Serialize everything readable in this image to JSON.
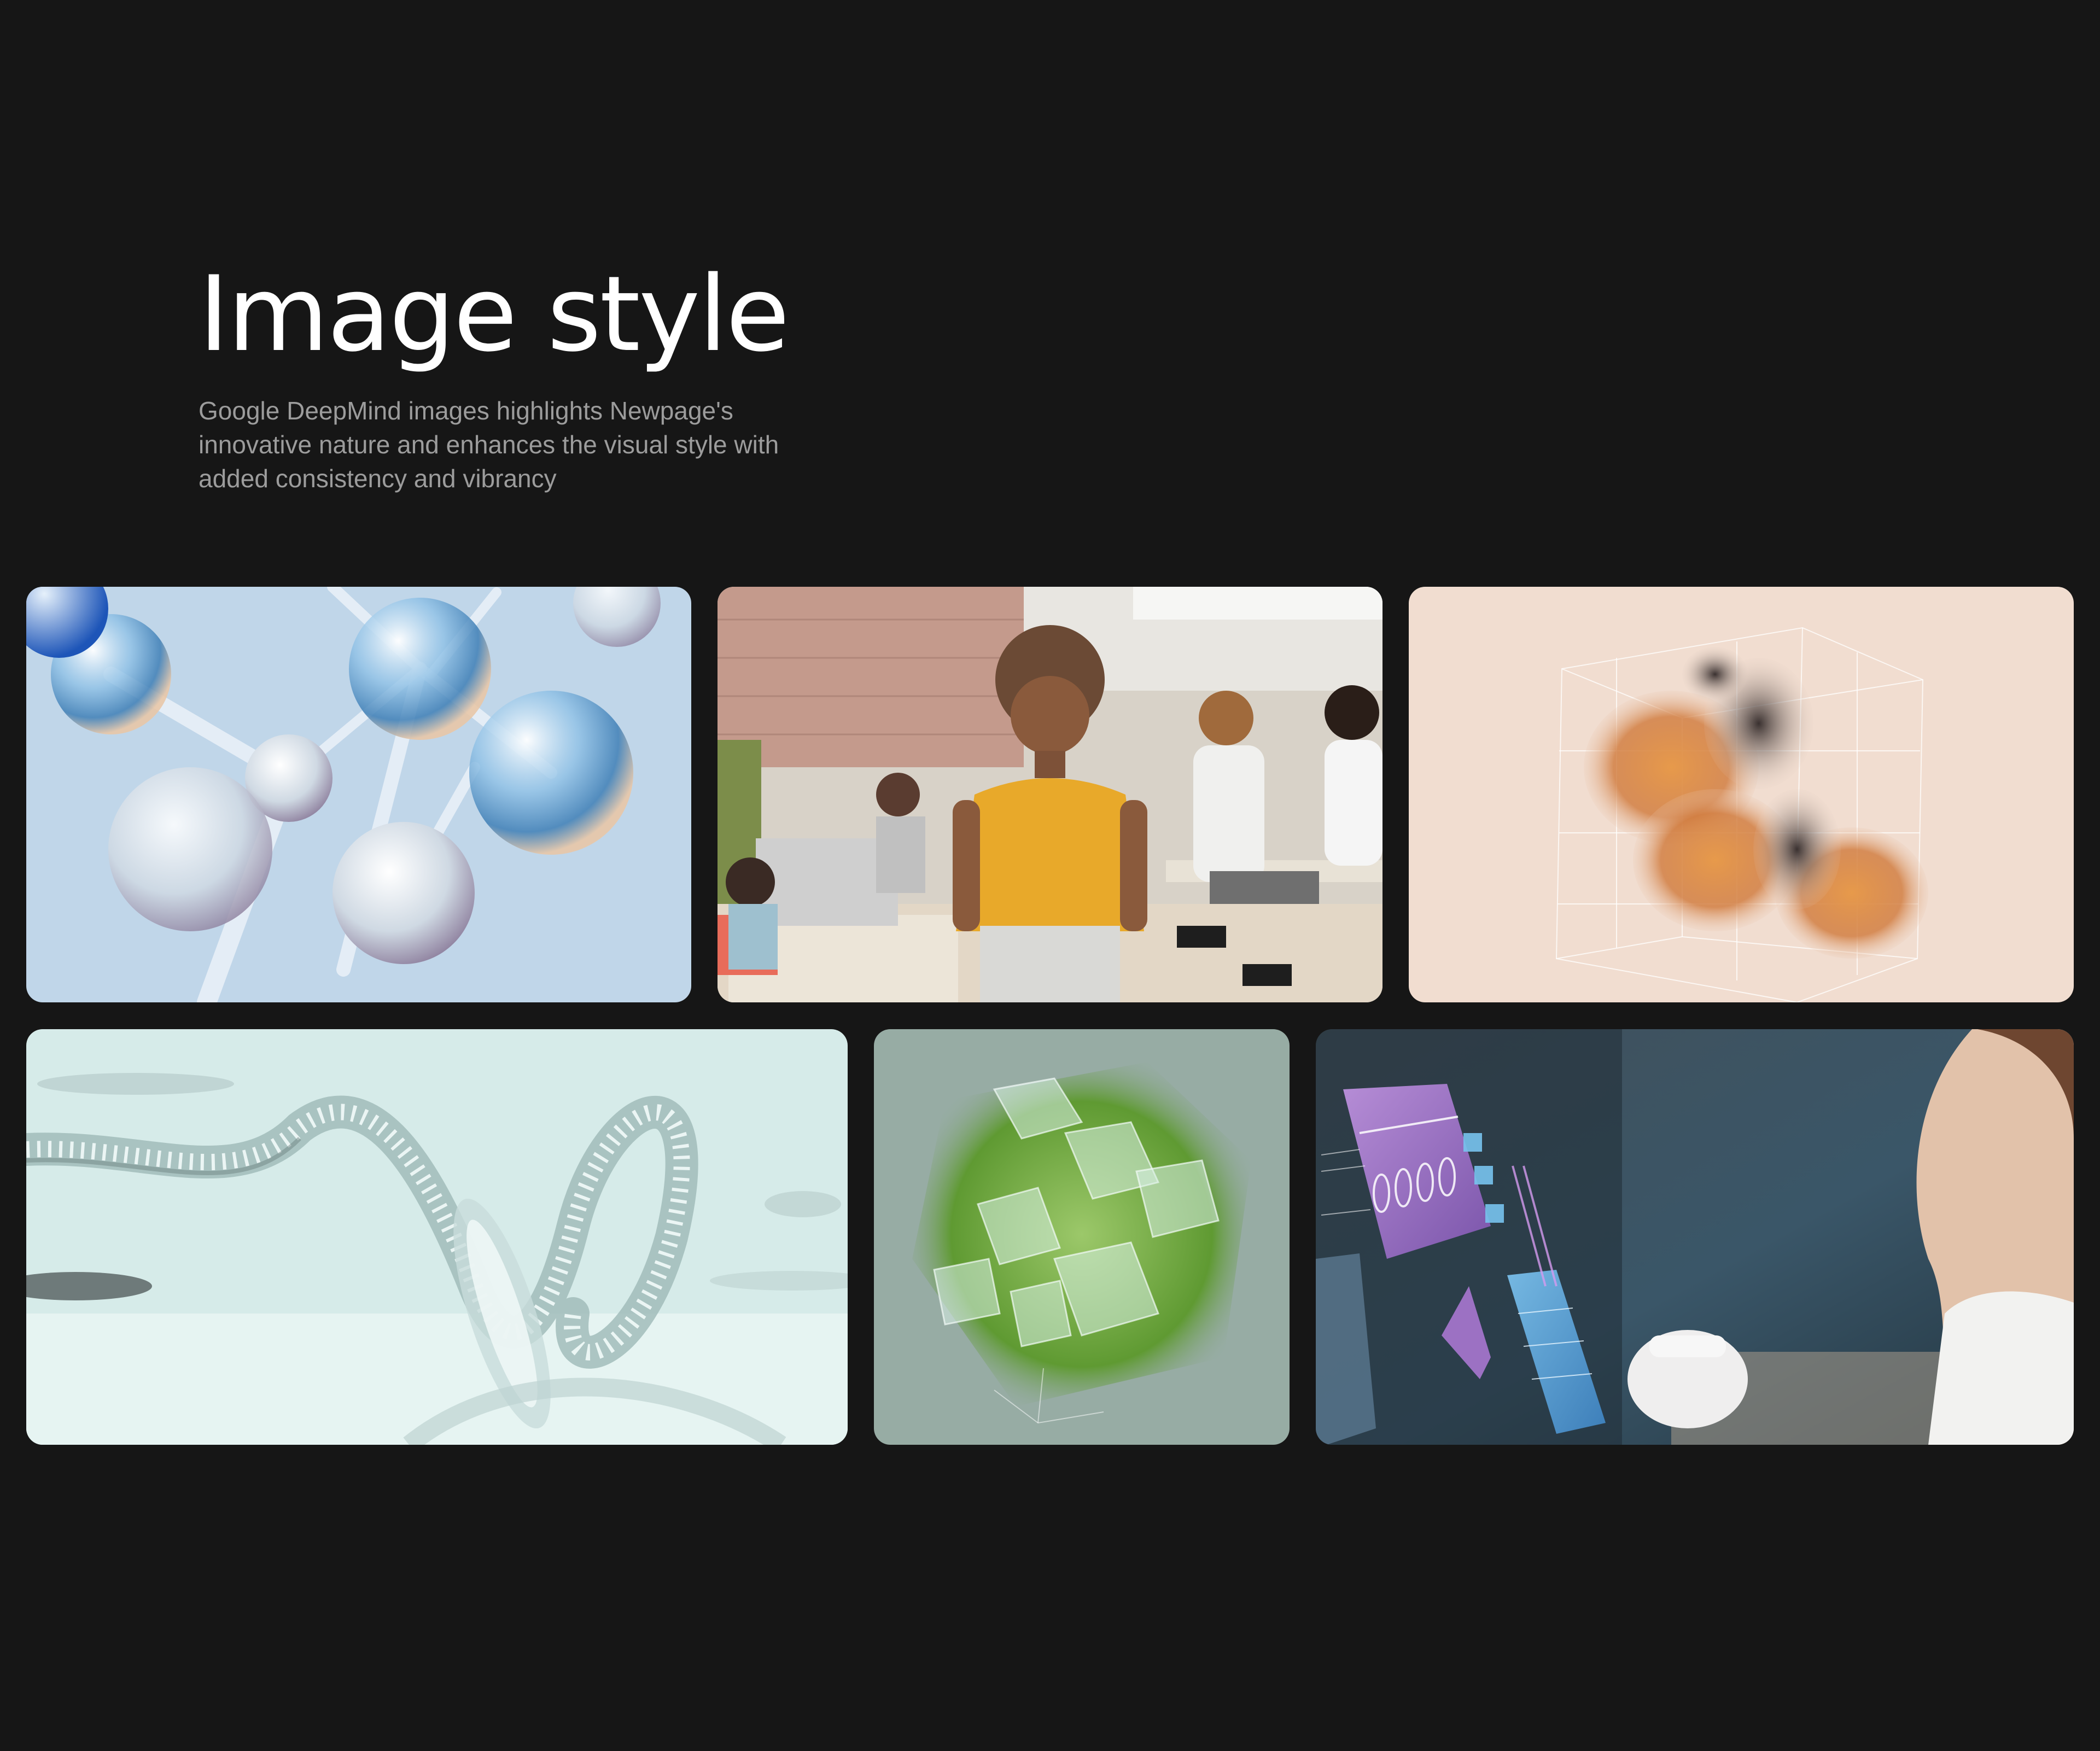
{
  "header": {
    "title": "Image style",
    "subtitle": "Google DeepMind images highlights Newpage's innovative nature and enhances the visual style with added consistency and vibrancy"
  },
  "gallery": {
    "tiles": [
      {
        "name": "glass-molecules-image",
        "background": "#c0d6e9",
        "accent": "#5a9cd0"
      },
      {
        "name": "office-portrait-image",
        "background": "#d8d2c8",
        "accent": "#e8a92a"
      },
      {
        "name": "particle-cube-image",
        "background": "#f1ddd0",
        "accent": "#d9873a"
      },
      {
        "name": "glass-spiral-image",
        "background": "#d6ebe9",
        "accent": "#9eb9b7"
      },
      {
        "name": "green-crystal-cube-image",
        "background": "#97aca4",
        "accent": "#6ea43c"
      },
      {
        "name": "holographic-interface-image",
        "background": "#2f4552",
        "accent": "#b07ad8"
      }
    ]
  }
}
